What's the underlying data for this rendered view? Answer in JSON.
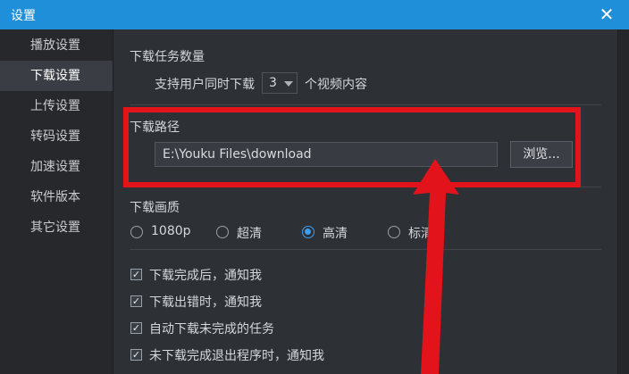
{
  "window": {
    "title": "设置"
  },
  "sidebar": {
    "items": [
      {
        "label": "播放设置"
      },
      {
        "label": "下载设置",
        "active": true
      },
      {
        "label": "上传设置"
      },
      {
        "label": "转码设置"
      },
      {
        "label": "加速设置"
      },
      {
        "label": "软件版本"
      },
      {
        "label": "其它设置"
      }
    ]
  },
  "download_tasks": {
    "section_title": "下载任务数量",
    "prefix": "支持用户同时下载",
    "value": "3",
    "suffix": "个视频内容"
  },
  "download_path": {
    "section_title": "下载路径",
    "value": "E:\\Youku Files\\download",
    "browse_label": "浏览..."
  },
  "quality": {
    "section_title": "下载画质",
    "options": [
      {
        "label": "1080p",
        "checked": false
      },
      {
        "label": "超清",
        "checked": false
      },
      {
        "label": "高清",
        "checked": true
      },
      {
        "label": "标清",
        "checked": false
      }
    ]
  },
  "notifications": [
    {
      "label": "下载完成后，通知我",
      "checked": true
    },
    {
      "label": "下载出错时，通知我",
      "checked": true
    },
    {
      "label": "自动下载未完成的任务",
      "checked": true
    },
    {
      "label": "未下载完成退出程序时，通知我",
      "checked": true
    }
  ],
  "colors": {
    "accent": "#1f8fd9",
    "annotation": "#e3131b"
  }
}
